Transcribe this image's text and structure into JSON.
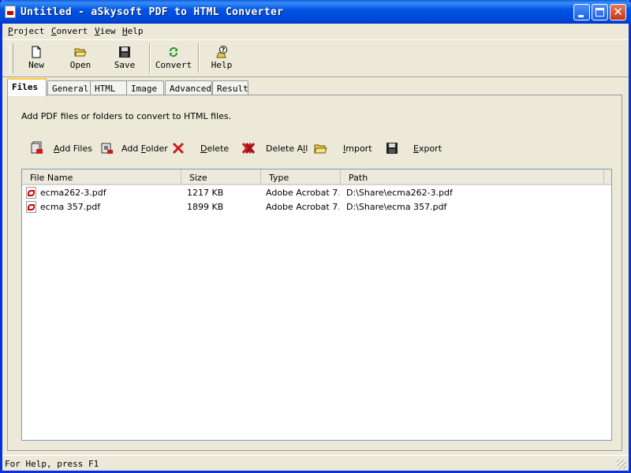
{
  "window": {
    "title": "Untitled - aSkysoft PDF to HTML Converter"
  },
  "menu": [
    {
      "key": "P",
      "rest": "roject"
    },
    {
      "key": "C",
      "rest": "onvert"
    },
    {
      "key": "V",
      "rest": "iew"
    },
    {
      "key": "H",
      "rest": "elp"
    }
  ],
  "toolbar": {
    "new": "New",
    "open": "Open",
    "save": "Save",
    "convert": "Convert",
    "help": "Help"
  },
  "tabs": [
    "Files",
    "General",
    "HTML",
    "Image",
    "Advanced",
    "Result"
  ],
  "active_tab": "Files",
  "files_panel": {
    "description": "Add PDF files or folders to convert to HTML files.",
    "actions": {
      "add_files": {
        "key": "A",
        "rest": "dd Files"
      },
      "add_folder": {
        "pre": "Add ",
        "key": "F",
        "rest": "older"
      },
      "delete": {
        "key": "D",
        "rest": "elete"
      },
      "delete_all": {
        "pre": "Delete A",
        "key": "l",
        "rest": "l"
      },
      "import": {
        "key": "I",
        "rest": "mport"
      },
      "export": {
        "key": "E",
        "rest": "xport"
      }
    },
    "columns": [
      "File Name",
      "Size",
      "Type",
      "Path"
    ],
    "rows": [
      {
        "name": "ecma262-3.pdf",
        "size": "1217 KB",
        "type": "Adobe Acrobat 7...",
        "path": "D:\\Share\\ecma262-3.pdf"
      },
      {
        "name": "ecma 357.pdf",
        "size": "1899 KB",
        "type": "Adobe Acrobat 7...",
        "path": "D:\\Share\\ecma 357.pdf"
      }
    ]
  },
  "status": {
    "text": "For Help, press F1"
  },
  "icons": {
    "app": "pdf-app-icon",
    "new": "new-document-icon",
    "open": "open-folder-icon",
    "save": "floppy-disk-icon",
    "convert": "convert-arrows-icon",
    "help": "help-icon",
    "add_files": "add-files-icon",
    "add_folder": "add-folder-icon",
    "delete": "red-x-icon",
    "delete_all": "red-double-x-icon",
    "import": "import-folder-icon",
    "export": "export-floppy-icon",
    "file": "pdf-file-icon"
  },
  "colors": {
    "titlebar": "#0055e5",
    "face": "#ece9d8",
    "tab_highlight": "#ffc83c",
    "delete_red": "#c81e1e"
  }
}
